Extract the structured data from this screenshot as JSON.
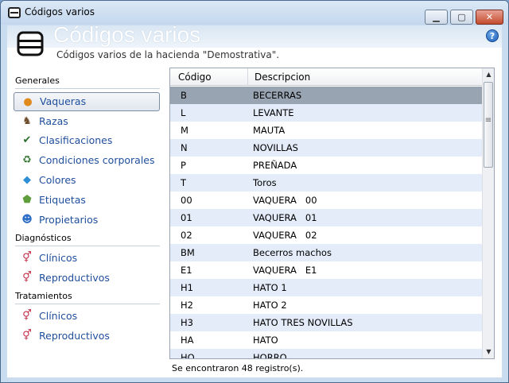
{
  "window": {
    "title": "Códigos varios",
    "min": "▁",
    "max": "▢",
    "close": "✕"
  },
  "header": {
    "title": "Códigos varios",
    "subtitle": "Códigos varios de la hacienda \"Demostrativa\".",
    "help": "?"
  },
  "sidebar": {
    "sections": [
      {
        "label": "Generales"
      },
      {
        "label": "Diagnósticos"
      },
      {
        "label": "Tratamientos"
      }
    ],
    "items": [
      {
        "label": "Vaqueras",
        "icon": "location-pin-icon",
        "glyph": "●",
        "color": "#e08a1e"
      },
      {
        "label": "Razas",
        "icon": "cattle-icon",
        "glyph": "♞",
        "color": "#6d4a2a"
      },
      {
        "label": "Clasificaciones",
        "icon": "checklist-icon",
        "glyph": "✔",
        "color": "#2b6e2b"
      },
      {
        "label": "Condiciones corporales",
        "icon": "recycle-icon",
        "glyph": "♻",
        "color": "#3a7a3a"
      },
      {
        "label": "Colores",
        "icon": "palette-icon",
        "glyph": "◆",
        "color": "#2f8fd6"
      },
      {
        "label": "Etiquetas",
        "icon": "tag-icon",
        "glyph": "⬟",
        "color": "#5f9e3a"
      },
      {
        "label": "Propietarios",
        "icon": "user-icon",
        "glyph": "☻",
        "color": "#2f6fc8"
      },
      {
        "label": "Clínicos",
        "icon": "gender-icon",
        "glyph": "⚥",
        "color": "#c2304a"
      },
      {
        "label": "Reproductivos",
        "icon": "gender-icon",
        "glyph": "⚥",
        "color": "#c2304a"
      },
      {
        "label": "Clínicos",
        "icon": "gender-icon",
        "glyph": "⚥",
        "color": "#c2304a"
      },
      {
        "label": "Reproductivos",
        "icon": "gender-icon",
        "glyph": "⚥",
        "color": "#c2304a"
      }
    ]
  },
  "grid": {
    "columns": [
      "Código",
      "Descripcion"
    ],
    "rows": [
      [
        "B",
        "BECERRAS"
      ],
      [
        "L",
        "LEVANTE"
      ],
      [
        "M",
        "MAUTA"
      ],
      [
        "N",
        "NOVILLAS"
      ],
      [
        "P",
        "PREÑADA"
      ],
      [
        "T",
        "Toros"
      ],
      [
        "00",
        "VAQUERA   00"
      ],
      [
        "01",
        "VAQUERA   01"
      ],
      [
        "02",
        "VAQUERA   02"
      ],
      [
        "BM",
        "Becerros machos"
      ],
      [
        "E1",
        "VAQUERA   E1"
      ],
      [
        "H1",
        "HATO 1"
      ],
      [
        "H2",
        "HATO 2"
      ],
      [
        "H3",
        "HATO TRES NOVILLAS"
      ],
      [
        "HA",
        "HATO"
      ],
      [
        "HO",
        "HORRO"
      ]
    ],
    "selected": 0
  },
  "scroll": {
    "up": "▲",
    "down": "▼"
  },
  "status": {
    "text": "Se encontraron 48 registro(s)."
  }
}
